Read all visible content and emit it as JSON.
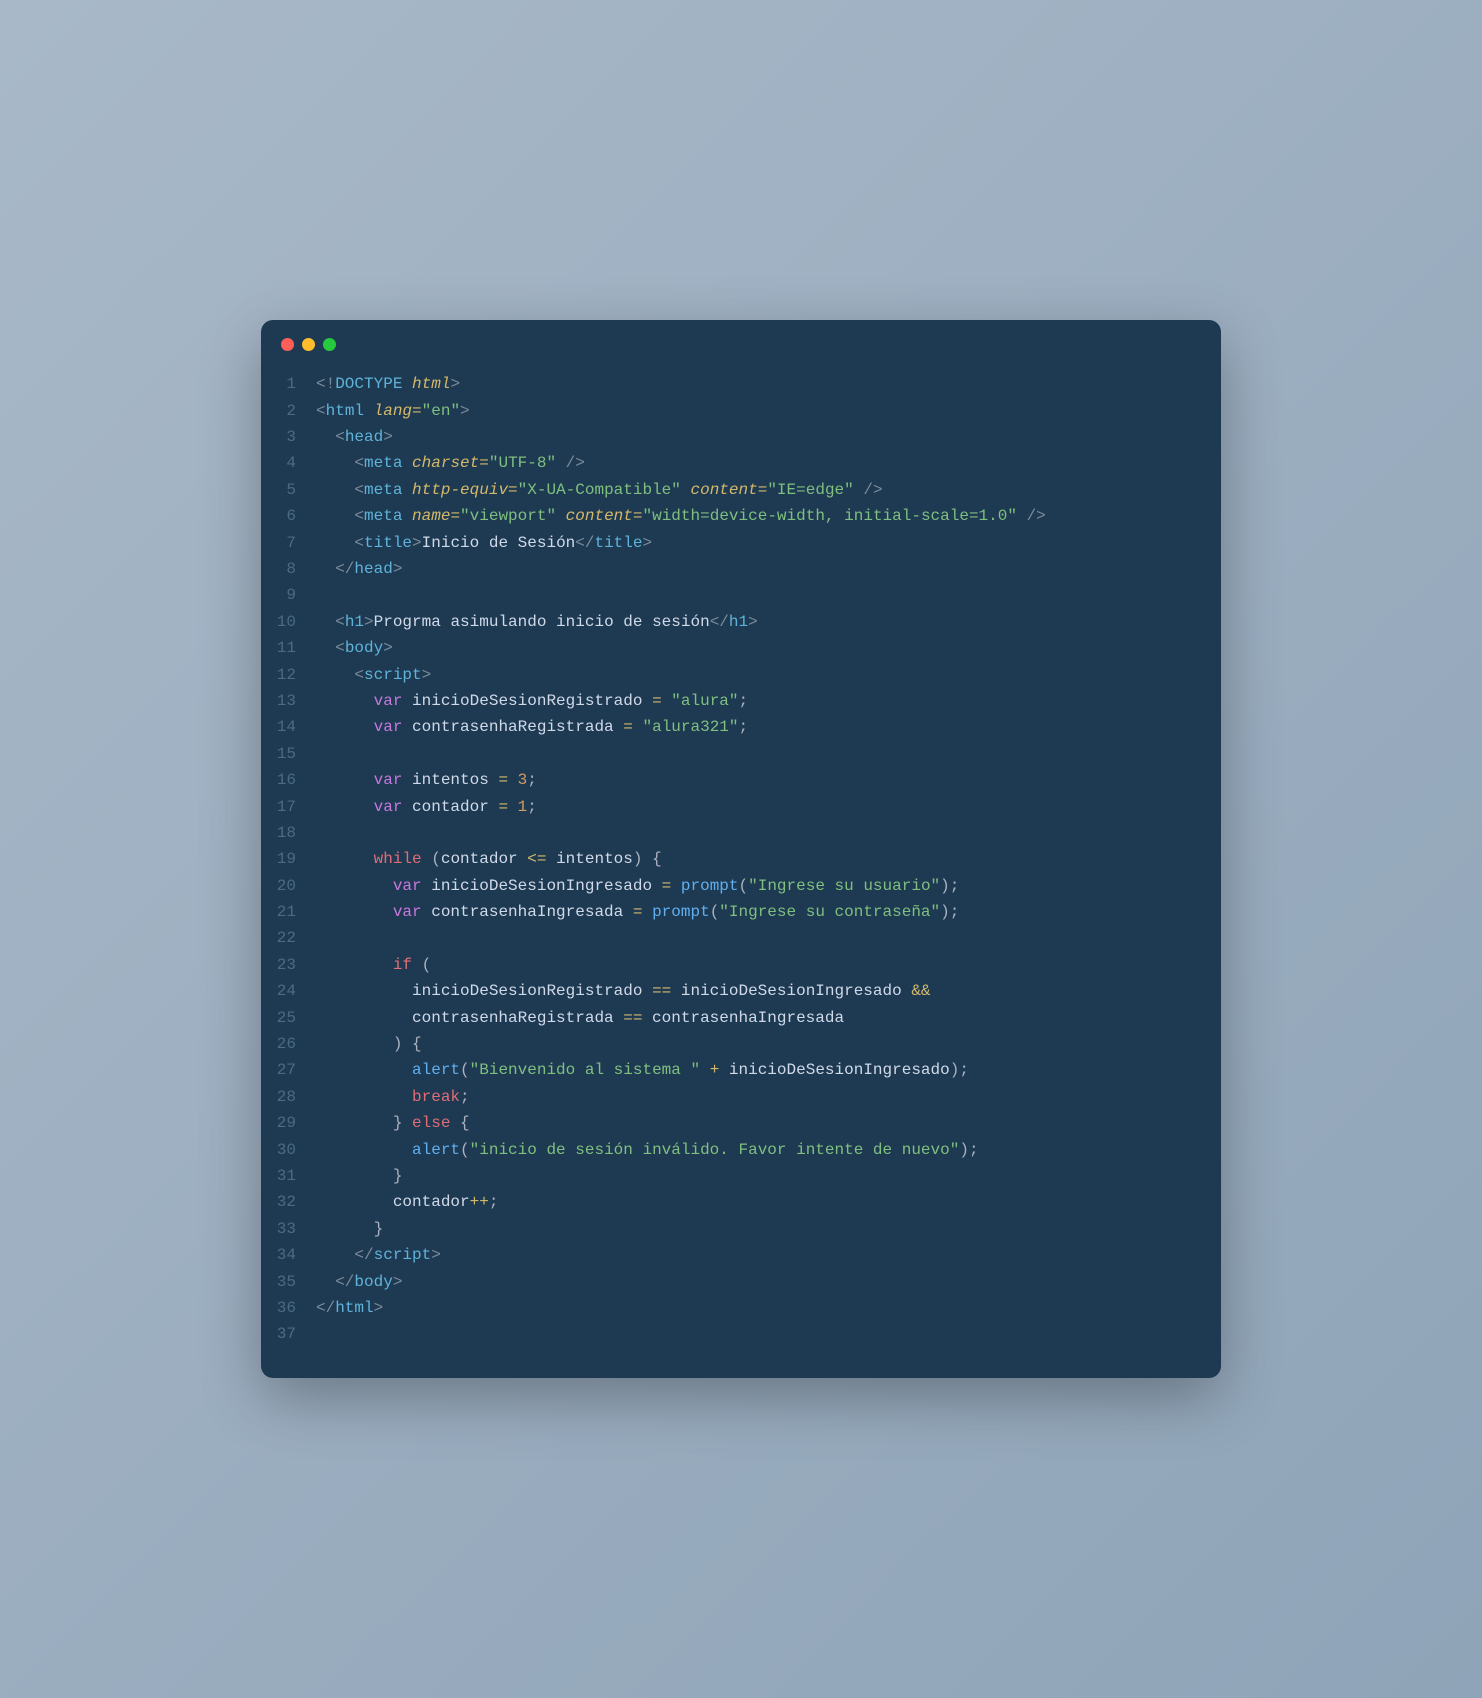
{
  "window": {
    "dots": [
      "red",
      "yellow",
      "green"
    ]
  },
  "code": {
    "lines": [
      {
        "n": 1,
        "indent": 0,
        "tokens": [
          [
            "tag-bracket",
            "<!"
          ],
          [
            "tag-name",
            "DOCTYPE"
          ],
          [
            "tag-bracket",
            " "
          ],
          [
            "attr-name",
            "html"
          ],
          [
            "tag-bracket",
            ">"
          ]
        ]
      },
      {
        "n": 2,
        "indent": 0,
        "tokens": [
          [
            "tag-bracket",
            "<"
          ],
          [
            "tag-name",
            "html"
          ],
          [
            "tag-bracket",
            " "
          ],
          [
            "attr-name",
            "lang"
          ],
          [
            "operator",
            "="
          ],
          [
            "attr-value",
            "\"en\""
          ],
          [
            "tag-bracket",
            ">"
          ]
        ]
      },
      {
        "n": 3,
        "indent": 2,
        "tokens": [
          [
            "tag-bracket",
            "<"
          ],
          [
            "tag-name",
            "head"
          ],
          [
            "tag-bracket",
            ">"
          ]
        ]
      },
      {
        "n": 4,
        "indent": 4,
        "tokens": [
          [
            "tag-bracket",
            "<"
          ],
          [
            "tag-name",
            "meta"
          ],
          [
            "tag-bracket",
            " "
          ],
          [
            "attr-name",
            "charset"
          ],
          [
            "operator",
            "="
          ],
          [
            "attr-value",
            "\"UTF-8\""
          ],
          [
            "tag-bracket",
            " />"
          ]
        ]
      },
      {
        "n": 5,
        "indent": 4,
        "tokens": [
          [
            "tag-bracket",
            "<"
          ],
          [
            "tag-name",
            "meta"
          ],
          [
            "tag-bracket",
            " "
          ],
          [
            "attr-name",
            "http-equiv"
          ],
          [
            "operator",
            "="
          ],
          [
            "attr-value",
            "\"X-UA-Compatible\""
          ],
          [
            "tag-bracket",
            " "
          ],
          [
            "attr-name",
            "content"
          ],
          [
            "operator",
            "="
          ],
          [
            "attr-value",
            "\"IE=edge\""
          ],
          [
            "tag-bracket",
            " />"
          ]
        ]
      },
      {
        "n": 6,
        "indent": 4,
        "tokens": [
          [
            "tag-bracket",
            "<"
          ],
          [
            "tag-name",
            "meta"
          ],
          [
            "tag-bracket",
            " "
          ],
          [
            "attr-name",
            "name"
          ],
          [
            "operator",
            "="
          ],
          [
            "attr-value",
            "\"viewport\""
          ],
          [
            "tag-bracket",
            " "
          ],
          [
            "attr-name",
            "content"
          ],
          [
            "operator",
            "="
          ],
          [
            "attr-value",
            "\"width=device-width, initial-scale=1.0\""
          ],
          [
            "tag-bracket",
            " />"
          ]
        ]
      },
      {
        "n": 7,
        "indent": 4,
        "tokens": [
          [
            "tag-bracket",
            "<"
          ],
          [
            "tag-name",
            "title"
          ],
          [
            "tag-bracket",
            ">"
          ],
          [
            "text-content",
            "Inicio de Sesión"
          ],
          [
            "tag-bracket",
            "</"
          ],
          [
            "tag-name",
            "title"
          ],
          [
            "tag-bracket",
            ">"
          ]
        ]
      },
      {
        "n": 8,
        "indent": 2,
        "tokens": [
          [
            "tag-bracket",
            "</"
          ],
          [
            "tag-name",
            "head"
          ],
          [
            "tag-bracket",
            ">"
          ]
        ]
      },
      {
        "n": 9,
        "indent": 0,
        "tokens": []
      },
      {
        "n": 10,
        "indent": 2,
        "tokens": [
          [
            "tag-bracket",
            "<"
          ],
          [
            "tag-name",
            "h1"
          ],
          [
            "tag-bracket",
            ">"
          ],
          [
            "text-content",
            "Progrma asimulando inicio de sesión"
          ],
          [
            "tag-bracket",
            "</"
          ],
          [
            "tag-name",
            "h1"
          ],
          [
            "tag-bracket",
            ">"
          ]
        ]
      },
      {
        "n": 11,
        "indent": 2,
        "tokens": [
          [
            "tag-bracket",
            "<"
          ],
          [
            "tag-name",
            "body"
          ],
          [
            "tag-bracket",
            ">"
          ]
        ]
      },
      {
        "n": 12,
        "indent": 4,
        "tokens": [
          [
            "tag-bracket",
            "<"
          ],
          [
            "tag-name",
            "script"
          ],
          [
            "tag-bracket",
            ">"
          ]
        ]
      },
      {
        "n": 13,
        "indent": 6,
        "tokens": [
          [
            "keyword-var",
            "var"
          ],
          [
            "variable",
            " inicioDeSesionRegistrado "
          ],
          [
            "operator",
            "="
          ],
          [
            "variable",
            " "
          ],
          [
            "string",
            "\"alura\""
          ],
          [
            "punct",
            ";"
          ]
        ]
      },
      {
        "n": 14,
        "indent": 6,
        "tokens": [
          [
            "keyword-var",
            "var"
          ],
          [
            "variable",
            " contrasenhaRegistrada "
          ],
          [
            "operator",
            "="
          ],
          [
            "variable",
            " "
          ],
          [
            "string",
            "\"alura321\""
          ],
          [
            "punct",
            ";"
          ]
        ]
      },
      {
        "n": 15,
        "indent": 0,
        "tokens": []
      },
      {
        "n": 16,
        "indent": 6,
        "tokens": [
          [
            "keyword-var",
            "var"
          ],
          [
            "variable",
            " intentos "
          ],
          [
            "operator",
            "="
          ],
          [
            "variable",
            " "
          ],
          [
            "number",
            "3"
          ],
          [
            "punct",
            ";"
          ]
        ]
      },
      {
        "n": 17,
        "indent": 6,
        "tokens": [
          [
            "keyword-var",
            "var"
          ],
          [
            "variable",
            " contador "
          ],
          [
            "operator",
            "="
          ],
          [
            "variable",
            " "
          ],
          [
            "number",
            "1"
          ],
          [
            "punct",
            ";"
          ]
        ]
      },
      {
        "n": 18,
        "indent": 0,
        "tokens": []
      },
      {
        "n": 19,
        "indent": 6,
        "tokens": [
          [
            "keyword",
            "while"
          ],
          [
            "variable",
            " "
          ],
          [
            "punct",
            "("
          ],
          [
            "variable",
            "contador "
          ],
          [
            "operator",
            "<="
          ],
          [
            "variable",
            " intentos"
          ],
          [
            "punct",
            ")"
          ],
          [
            "variable",
            " "
          ],
          [
            "punct",
            "{"
          ]
        ]
      },
      {
        "n": 20,
        "indent": 8,
        "tokens": [
          [
            "keyword-var",
            "var"
          ],
          [
            "variable",
            " inicioDeSesionIngresado "
          ],
          [
            "operator",
            "="
          ],
          [
            "variable",
            " "
          ],
          [
            "function",
            "prompt"
          ],
          [
            "punct",
            "("
          ],
          [
            "string",
            "\"Ingrese su usuario\""
          ],
          [
            "punct",
            ")"
          ],
          [
            "punct",
            ";"
          ]
        ]
      },
      {
        "n": 21,
        "indent": 8,
        "tokens": [
          [
            "keyword-var",
            "var"
          ],
          [
            "variable",
            " contrasenhaIngresada "
          ],
          [
            "operator",
            "="
          ],
          [
            "variable",
            " "
          ],
          [
            "function",
            "prompt"
          ],
          [
            "punct",
            "("
          ],
          [
            "string",
            "\"Ingrese su contraseña\""
          ],
          [
            "punct",
            ")"
          ],
          [
            "punct",
            ";"
          ]
        ]
      },
      {
        "n": 22,
        "indent": 0,
        "tokens": []
      },
      {
        "n": 23,
        "indent": 8,
        "tokens": [
          [
            "keyword",
            "if"
          ],
          [
            "variable",
            " "
          ],
          [
            "punct",
            "("
          ]
        ]
      },
      {
        "n": 24,
        "indent": 10,
        "tokens": [
          [
            "variable",
            "inicioDeSesionRegistrado "
          ],
          [
            "operator",
            "=="
          ],
          [
            "variable",
            " inicioDeSesionIngresado "
          ],
          [
            "operator",
            "&&"
          ]
        ]
      },
      {
        "n": 25,
        "indent": 10,
        "tokens": [
          [
            "variable",
            "contrasenhaRegistrada "
          ],
          [
            "operator",
            "=="
          ],
          [
            "variable",
            " contrasenhaIngresada"
          ]
        ]
      },
      {
        "n": 26,
        "indent": 8,
        "tokens": [
          [
            "punct",
            ")"
          ],
          [
            "variable",
            " "
          ],
          [
            "punct",
            "{"
          ]
        ]
      },
      {
        "n": 27,
        "indent": 10,
        "tokens": [
          [
            "function",
            "alert"
          ],
          [
            "punct",
            "("
          ],
          [
            "string",
            "\"Bienvenido al sistema \""
          ],
          [
            "variable",
            " "
          ],
          [
            "operator",
            "+"
          ],
          [
            "variable",
            " inicioDeSesionIngresado"
          ],
          [
            "punct",
            ")"
          ],
          [
            "punct",
            ";"
          ]
        ]
      },
      {
        "n": 28,
        "indent": 10,
        "tokens": [
          [
            "keyword",
            "break"
          ],
          [
            "punct",
            ";"
          ]
        ]
      },
      {
        "n": 29,
        "indent": 8,
        "tokens": [
          [
            "punct",
            "}"
          ],
          [
            "variable",
            " "
          ],
          [
            "keyword",
            "else"
          ],
          [
            "variable",
            " "
          ],
          [
            "punct",
            "{"
          ]
        ]
      },
      {
        "n": 30,
        "indent": 10,
        "tokens": [
          [
            "function",
            "alert"
          ],
          [
            "punct",
            "("
          ],
          [
            "string",
            "\"inicio de sesión inválido. Favor intente de nuevo\""
          ],
          [
            "punct",
            ")"
          ],
          [
            "punct",
            ";"
          ]
        ]
      },
      {
        "n": 31,
        "indent": 8,
        "tokens": [
          [
            "punct",
            "}"
          ]
        ]
      },
      {
        "n": 32,
        "indent": 8,
        "tokens": [
          [
            "variable",
            "contador"
          ],
          [
            "operator",
            "++"
          ],
          [
            "punct",
            ";"
          ]
        ]
      },
      {
        "n": 33,
        "indent": 6,
        "tokens": [
          [
            "punct",
            "}"
          ]
        ]
      },
      {
        "n": 34,
        "indent": 4,
        "tokens": [
          [
            "tag-bracket",
            "</"
          ],
          [
            "tag-name",
            "script"
          ],
          [
            "tag-bracket",
            ">"
          ]
        ]
      },
      {
        "n": 35,
        "indent": 2,
        "tokens": [
          [
            "tag-bracket",
            "</"
          ],
          [
            "tag-name",
            "body"
          ],
          [
            "tag-bracket",
            ">"
          ]
        ]
      },
      {
        "n": 36,
        "indent": 0,
        "tokens": [
          [
            "tag-bracket",
            "</"
          ],
          [
            "tag-name",
            "html"
          ],
          [
            "tag-bracket",
            ">"
          ]
        ]
      },
      {
        "n": 37,
        "indent": 0,
        "tokens": []
      }
    ]
  }
}
